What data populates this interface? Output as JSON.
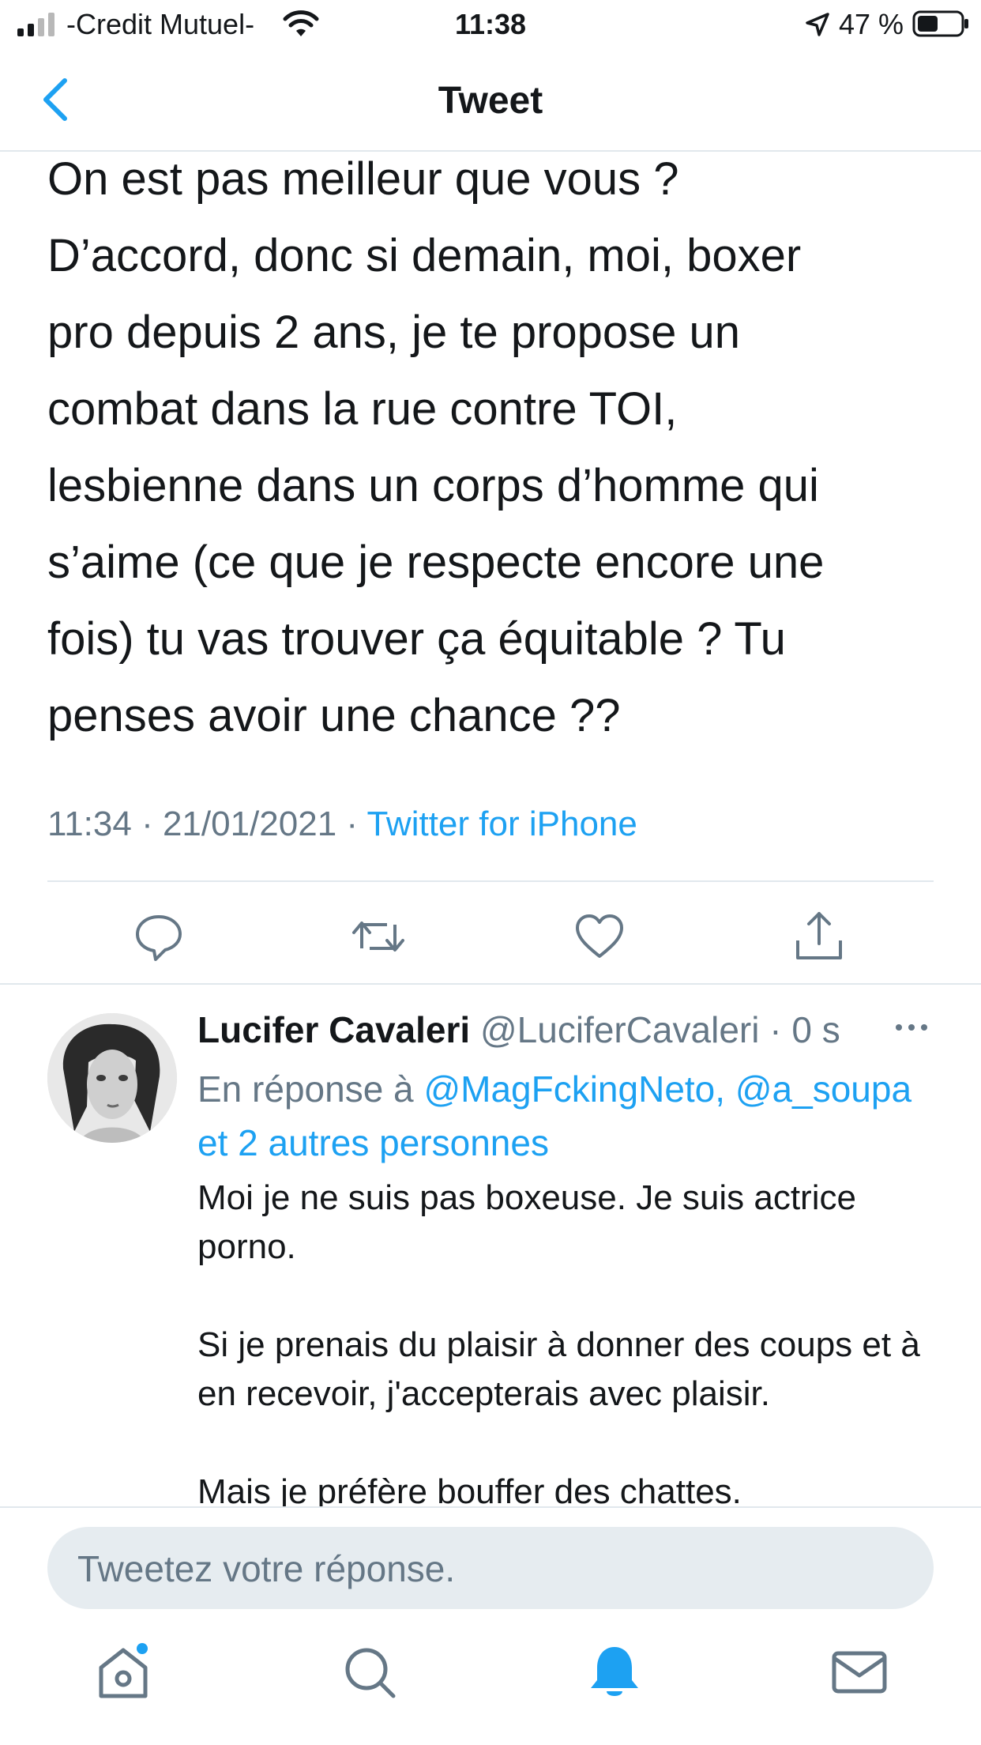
{
  "status_bar": {
    "carrier": "-Credit Mutuel-",
    "time": "11:38",
    "battery": "47 %"
  },
  "nav": {
    "title": "Tweet",
    "back_icon": "chevron-left-icon"
  },
  "tweet": {
    "text_lines": [
      "On est pas meilleur que vous ?",
      "D’accord, donc si demain, moi, boxer",
      "pro depuis 2 ans, je te propose un",
      "combat dans la rue contre TOI,",
      "lesbienne dans un corps d’homme qui",
      "s’aime (ce que je respecte encore une",
      "fois) tu vas trouver ça équitable ? Tu",
      "penses avoir une chance ??"
    ],
    "time": "11:34",
    "date": "21/01/2021",
    "source": "Twitter for iPhone",
    "separator": " · "
  },
  "actions": {
    "reply_icon": "reply-icon",
    "retweet_icon": "retweet-icon",
    "like_icon": "heart-icon",
    "share_icon": "share-icon"
  },
  "reply": {
    "name": "Lucifer Cavaleri",
    "handle": "@LuciferCavaleri",
    "age": "· 0 s",
    "reply_prefix": "En réponse à",
    "mention_1": "@MagFckingNeto,",
    "mention_2": "@a_soupa",
    "mention_others": "et 2 autres personnes",
    "body": [
      "Moi je ne suis pas boxeuse. Je suis actrice porno.",
      "Si je prenais du plaisir à donner des coups et à en recevoir, j'accepterais avec plaisir.",
      "Mais je préfère bouffer des chattes."
    ]
  },
  "compose": {
    "placeholder": "Tweetez votre réponse."
  },
  "tabs": {
    "home_icon": "home-icon",
    "search_icon": "search-icon",
    "notifications_icon": "bell-icon",
    "messages_icon": "mail-icon"
  },
  "colors": {
    "accent": "#1da1f2",
    "text": "#14171a",
    "secondary": "#657786",
    "divider": "#e1e8ed",
    "compose_bg": "#e6ecf0"
  }
}
